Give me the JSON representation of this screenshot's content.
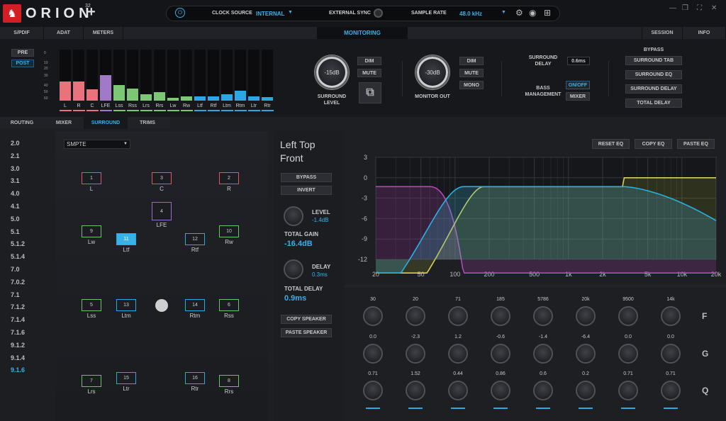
{
  "app": {
    "brand": "ORION",
    "brand_sup": "32",
    "brand_plus": "+"
  },
  "topbar": {
    "clock_label": "CLOCK SOURCE",
    "clock_value": "INTERNAL",
    "ext_sync_label": "EXTERNAL SYNC",
    "sample_rate_label": "SAMPLE RATE",
    "sample_rate_value": "48.0 kHz"
  },
  "tabs_top": [
    "S/PDIF",
    "ADAT",
    "METERS",
    "MONITORING",
    "SESSION",
    "INFO"
  ],
  "meters": {
    "pre": "PRE",
    "post": "POST",
    "scale": [
      "0",
      "10",
      "20",
      "30",
      "40",
      "50",
      "60"
    ],
    "channels": [
      {
        "name": "L",
        "level": 0.38,
        "color": "#e8737d"
      },
      {
        "name": "R",
        "level": 0.38,
        "color": "#e8737d"
      },
      {
        "name": "C",
        "level": 0.22,
        "color": "#e8737d"
      },
      {
        "name": "LFE",
        "level": 0.5,
        "color": "#a07ac8"
      },
      {
        "name": "Lss",
        "level": 0.3,
        "color": "#7cc675"
      },
      {
        "name": "Rss",
        "level": 0.24,
        "color": "#7cc675"
      },
      {
        "name": "Lrs",
        "level": 0.12,
        "color": "#7cc675"
      },
      {
        "name": "Rrs",
        "level": 0.16,
        "color": "#7cc675"
      },
      {
        "name": "Lw",
        "level": 0.05,
        "color": "#7cc675"
      },
      {
        "name": "Rw",
        "level": 0.09,
        "color": "#7cc675"
      },
      {
        "name": "Ltf",
        "level": 0.09,
        "color": "#2aa8e0"
      },
      {
        "name": "Rtf",
        "level": 0.09,
        "color": "#2aa8e0"
      },
      {
        "name": "Ltm",
        "level": 0.13,
        "color": "#2aa8e0"
      },
      {
        "name": "Rtm",
        "level": 0.19,
        "color": "#2aa8e0"
      },
      {
        "name": "Ltr",
        "level": 0.09,
        "color": "#2aa8e0"
      },
      {
        "name": "Rtr",
        "level": 0.07,
        "color": "#2aa8e0"
      }
    ]
  },
  "surround_level": {
    "value": "-15dB",
    "label": "SURROUND LEVEL",
    "dim": "DIM",
    "mute": "MUTE"
  },
  "monitor_out": {
    "value": "-30dB",
    "label": "MONITOR OUT",
    "dim": "DIM",
    "mute": "MUTE",
    "mono": "MONO"
  },
  "surround_delay": {
    "label": "SURROUND DELAY",
    "value": "0.6ms"
  },
  "bass_mgmt": {
    "label": "BASS MANAGEMENT",
    "onoff": "ON/OFF",
    "mixer": "MIXER"
  },
  "bypass": {
    "title": "BYPASS",
    "items": [
      "SURROUND TAB",
      "SURROUND EQ",
      "SURROUND DELAY",
      "TOTAL DELAY"
    ]
  },
  "tabs_sub": [
    "ROUTING",
    "MIXER",
    "SURROUND",
    "TRIMS"
  ],
  "formats": [
    "2.0",
    "2.1",
    "3.0",
    "3.1",
    "4.0",
    "4.1",
    "5.0",
    "5.1",
    "5.1.2",
    "5.1.4",
    "7.0",
    "7.0.2",
    "7.1",
    "7.1.2",
    "7.1.4",
    "7.1.6",
    "9.1.2",
    "9.1.4",
    "9.1.6"
  ],
  "format_select": "SMPTE",
  "speakers": [
    {
      "n": "1",
      "name": "L",
      "x": 37,
      "y": 58,
      "c": "#e05560"
    },
    {
      "n": "3",
      "name": "C",
      "x": 136,
      "y": 58,
      "c": "#e05560"
    },
    {
      "n": "2",
      "name": "R",
      "x": 231,
      "y": 58,
      "c": "#e05560"
    },
    {
      "n": "4",
      "name": "LFE",
      "x": 136,
      "y": 100,
      "c": "#9a6cc8",
      "tall": true
    },
    {
      "n": "9",
      "name": "Lw",
      "x": 37,
      "y": 133,
      "c": "#6fc06a"
    },
    {
      "n": "11",
      "name": "Ltf",
      "x": 86,
      "y": 144,
      "c": "#2aa8e0",
      "active": true
    },
    {
      "n": "12",
      "name": "Rtf",
      "x": 183,
      "y": 144,
      "c": "#2aa8e0"
    },
    {
      "n": "10",
      "name": "Rw",
      "x": 231,
      "y": 133,
      "c": "#6fc06a"
    },
    {
      "n": "5",
      "name": "Lss",
      "x": 37,
      "y": 237,
      "c": "#6fc06a"
    },
    {
      "n": "13",
      "name": "Ltm",
      "x": 86,
      "y": 237,
      "c": "#2aa8e0"
    },
    {
      "n": "14",
      "name": "Rtm",
      "x": 183,
      "y": 237,
      "c": "#2aa8e0"
    },
    {
      "n": "6",
      "name": "Rss",
      "x": 231,
      "y": 237,
      "c": "#6fc06a"
    },
    {
      "n": "7",
      "name": "Lrs",
      "x": 37,
      "y": 344,
      "c": "#6fc06a"
    },
    {
      "n": "15",
      "name": "Ltr",
      "x": 86,
      "y": 340,
      "c": "#2aa8e0"
    },
    {
      "n": "16",
      "name": "Rtr",
      "x": 183,
      "y": 340,
      "c": "#2aa8e0"
    },
    {
      "n": "8",
      "name": "Rrs",
      "x": 231,
      "y": 344,
      "c": "#6fc06a"
    }
  ],
  "channel": {
    "title_line1": "Left Top",
    "title_line2": "Front",
    "bypass": "BYPASS",
    "invert": "INVERT",
    "level_label": "LEVEL",
    "level_value": "-1.4dB",
    "total_gain_label": "TOTAL GAIN",
    "total_gain_value": "-16.4dB",
    "delay_label": "DELAY",
    "delay_value": "0.3ms",
    "total_delay_label": "TOTAL DELAY",
    "total_delay_value": "0.9ms",
    "copy_speaker": "COPY SPEAKER",
    "paste_speaker": "PASTE SPEAKER"
  },
  "eq": {
    "reset": "RESET EQ",
    "copy": "COPY EQ",
    "paste": "PASTE EQ",
    "y_ticks": [
      "3",
      "0",
      "-3",
      "-6",
      "-9",
      "-12"
    ],
    "x_ticks": [
      "20",
      "50",
      "100",
      "200",
      "500",
      "1k",
      "2k",
      "5k",
      "10k",
      "20k"
    ],
    "bands_f": [
      "30",
      "20",
      "71",
      "185",
      "5786",
      "20k",
      "9500",
      "14k"
    ],
    "bands_g": [
      "0.0",
      "-2.3",
      "1.2",
      "-0.6",
      "-1.4",
      "-6.4",
      "0.0",
      "0.0"
    ],
    "bands_q": [
      "0.71",
      "1.52",
      "0.44",
      "0.86",
      "0.6",
      "0.2",
      "0.71",
      "0.71"
    ],
    "row_labels": [
      "F",
      "G",
      "Q"
    ]
  }
}
